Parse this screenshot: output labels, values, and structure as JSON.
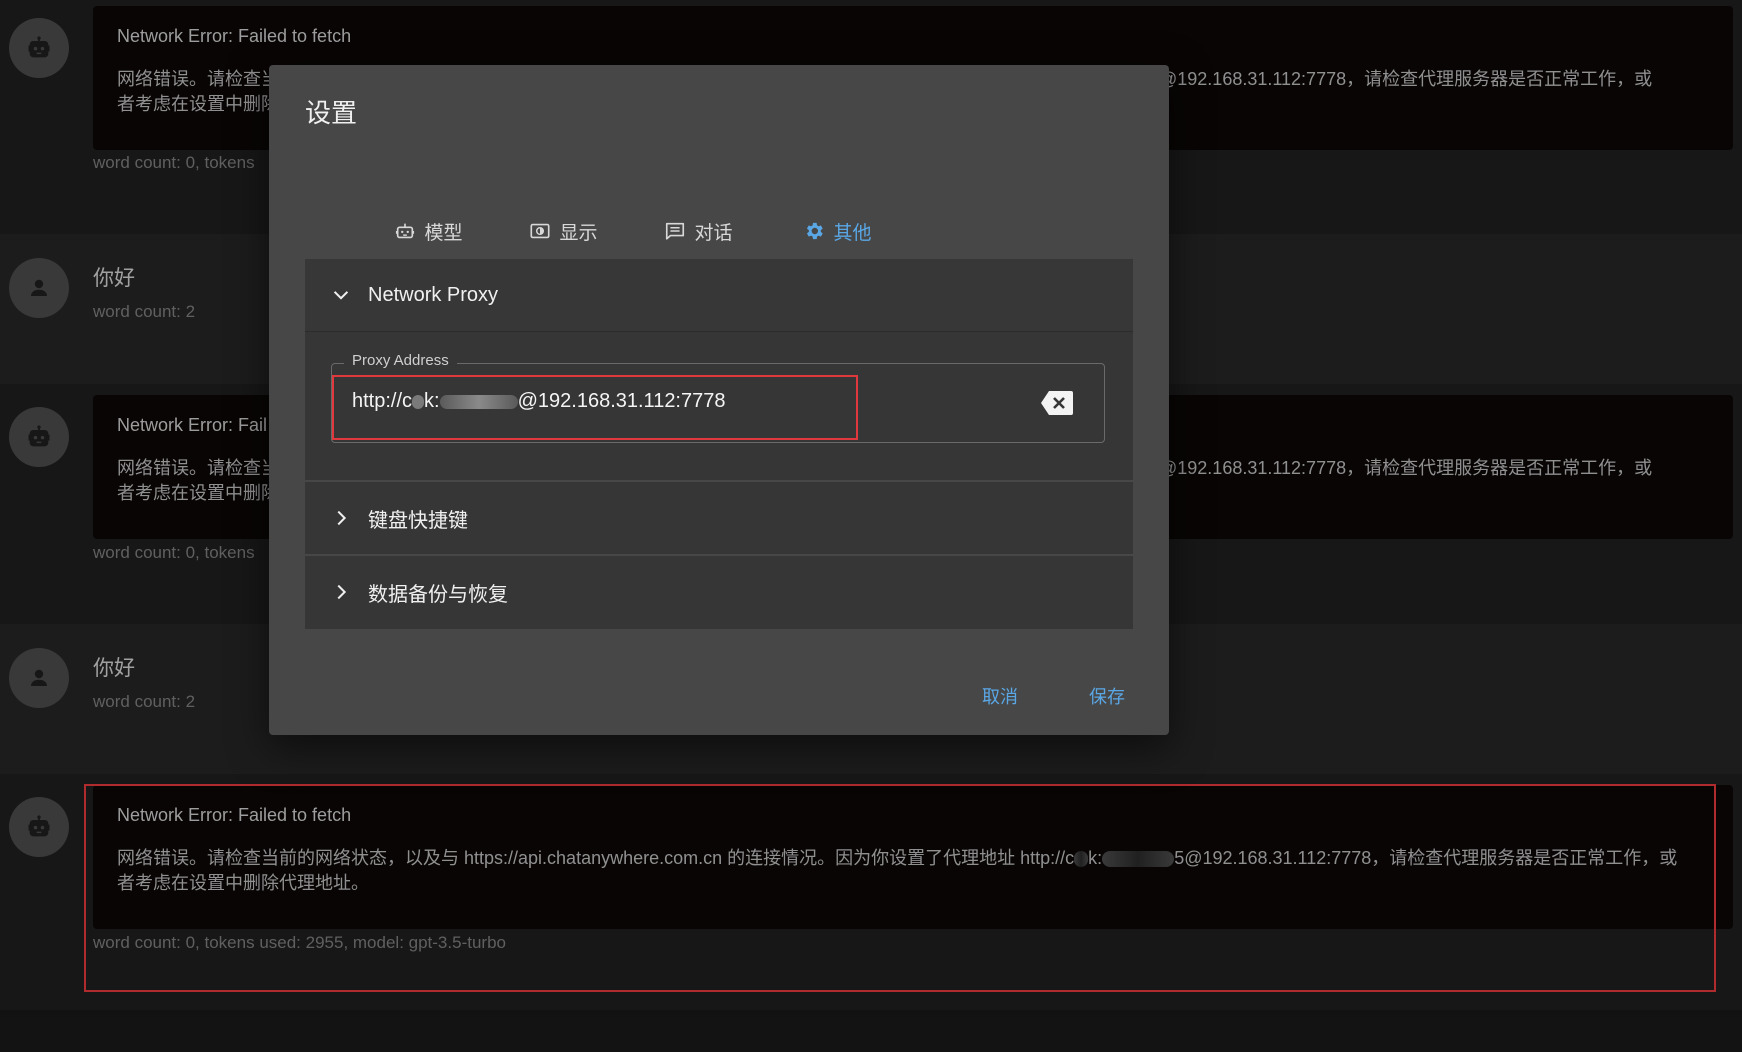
{
  "chat": {
    "error": {
      "title": "Network Error: Failed to fetch",
      "body_line1_prefix": "网络错误。请检查当前的网络状态，以及与 https://api.chatanywhere.com.cn 的连接情况。因为你设置了代理地址 http://c",
      "body_line1_mid": "k:",
      "body_line1_suffix": "5@192.168.31.112:7778，请检查代理服务器是否正常工作，或",
      "body_line2": "者考虑在设置中删除代理地址。",
      "visible_left_1": "网络错误。请检查当",
      "visible_left_2": "者考虑在设置中删除",
      "visible_right_1": "@192.168.31.112:7778，请检查代理服务器是否正常工作，或",
      "visible_right_2": "@192.168.31.112:7778，请检查代理服务器是否正常工作，或",
      "title_cut": "Network Error: Fail"
    },
    "wordcount_assistant_cut": "word count: 0, tokens",
    "wordcount_assistant_full": "word count: 0, tokens used: 2955, model: gpt-3.5-turbo",
    "user_message": "你好",
    "wordcount_user": "word count: 2"
  },
  "dialog": {
    "title": "设置",
    "tabs": [
      {
        "label": "模型",
        "icon": "robot-icon"
      },
      {
        "label": "显示",
        "icon": "display-icon"
      },
      {
        "label": "对话",
        "icon": "chat-icon"
      },
      {
        "label": "其他",
        "icon": "gear-icon",
        "active": true
      }
    ],
    "sections": {
      "network_proxy": {
        "title": "Network Proxy",
        "expanded": true,
        "field_label": "Proxy Address",
        "value_prefix": "http://c",
        "value_mid": "k:",
        "value_suffix": "@192.168.31.112:7778"
      },
      "keyboard": {
        "title": "键盘快捷键",
        "expanded": false
      },
      "backup": {
        "title": "数据备份与恢复",
        "expanded": false
      }
    },
    "buttons": {
      "cancel": "取消",
      "save": "保存"
    }
  },
  "colors": {
    "accent": "#5aa7e6",
    "highlight_red": "#e0383c",
    "dialog_bg": "#474747",
    "panel_bg": "#363636"
  }
}
